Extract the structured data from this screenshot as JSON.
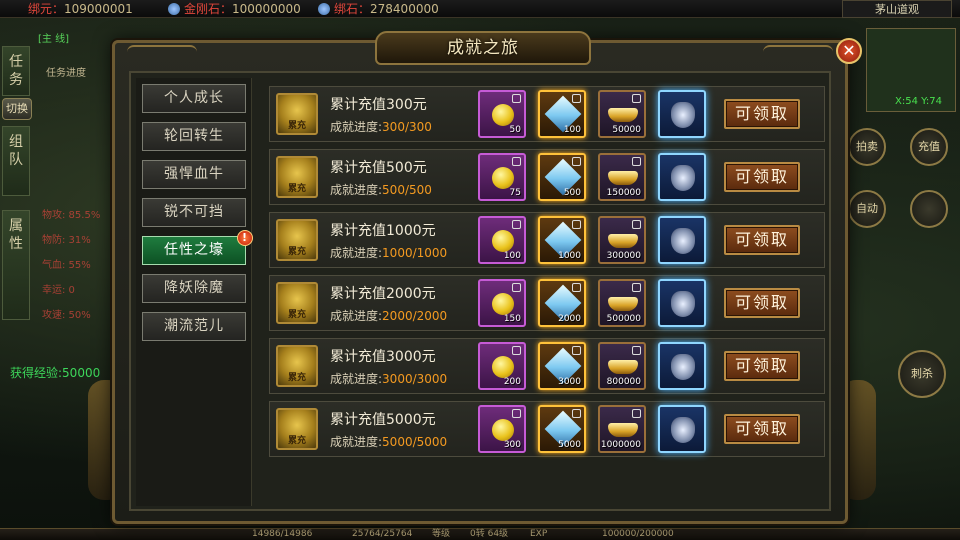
{
  "topbar": {
    "resources": [
      {
        "label": "绑元：",
        "value": "109000001"
      },
      {
        "label": "金刚石：",
        "value": "100000000"
      },
      {
        "label": "绑石：",
        "value": "278400000"
      }
    ],
    "map_name": "茅山道观"
  },
  "left_panel": {
    "task_tab": "任务",
    "switch_button": "切换",
    "team_tab": "组队",
    "attr_tab": "属性",
    "quest_name": "[主 线]",
    "quest_progress": "任务进度",
    "stats": [
      "物攻: 85.5%",
      "物防: 31%",
      "气血: 55%",
      "幸运: 0",
      "攻速: 50%"
    ],
    "exp_gain": "获得经验:50000"
  },
  "right_panel": {
    "coords": "X:54 Y:74",
    "buttons": [
      "拍卖",
      "充值",
      "自动",
      "",
      "刺杀"
    ]
  },
  "bottombar": {
    "hp": "14986/14986",
    "mp": "25764/25764",
    "level_label": "等级",
    "level_value": "0转 64级",
    "exp_label": "EXP",
    "exp_value": "100000/200000"
  },
  "dialog": {
    "title": "成就之旅",
    "close_glyph": "✕",
    "menu": [
      {
        "label": "个人成长",
        "active": false
      },
      {
        "label": "轮回转生",
        "active": false
      },
      {
        "label": "强悍血牛",
        "active": false
      },
      {
        "label": "锐不可挡",
        "active": false
      },
      {
        "label": "任性之壕",
        "active": true,
        "badge": "!"
      },
      {
        "label": "降妖除魔",
        "active": false
      },
      {
        "label": "潮流范儿",
        "active": false
      }
    ],
    "achievement_icon_text": "累充",
    "progress_label": "成就进度:",
    "claim_label": "可领取",
    "rows": [
      {
        "title": "累计充值300元",
        "progress": "300/300",
        "rewards": [
          "50",
          "100",
          "50000",
          ""
        ]
      },
      {
        "title": "累计充值500元",
        "progress": "500/500",
        "rewards": [
          "75",
          "500",
          "150000",
          ""
        ]
      },
      {
        "title": "累计充值1000元",
        "progress": "1000/1000",
        "rewards": [
          "100",
          "1000",
          "300000",
          ""
        ]
      },
      {
        "title": "累计充值2000元",
        "progress": "2000/2000",
        "rewards": [
          "150",
          "2000",
          "500000",
          ""
        ]
      },
      {
        "title": "累计充值3000元",
        "progress": "3000/3000",
        "rewards": [
          "200",
          "3000",
          "800000",
          ""
        ]
      },
      {
        "title": "累计充值5000元",
        "progress": "5000/5000",
        "rewards": [
          "300",
          "5000",
          "1000000",
          ""
        ]
      }
    ],
    "reward_icons": [
      "gold-coin-icon",
      "diamond-gem-icon",
      "gold-ingot-icon",
      "armor-icon"
    ]
  }
}
